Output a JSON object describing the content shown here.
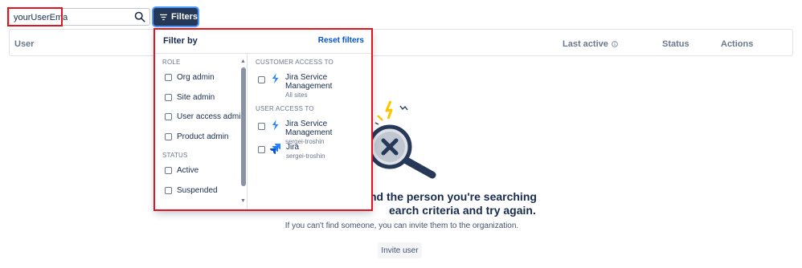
{
  "search": {
    "value": "yourUserEmail"
  },
  "filters_button": {
    "label": "Filters"
  },
  "table": {
    "columns": {
      "user": "User",
      "last_active": "Last active",
      "status": "Status",
      "actions": "Actions"
    }
  },
  "empty_state": {
    "title_line1": "nd the person you're searching",
    "title_line2": "earch criteria and try again.",
    "subtitle": "If you can't find someone, you can invite them to the organization.",
    "invite_label": "Invite user"
  },
  "filter_panel": {
    "title": "Filter by",
    "reset_label": "Reset filters",
    "role_section": "ROLE",
    "roles": [
      "Org admin",
      "Site admin",
      "User access admin",
      "Product admin"
    ],
    "status_section": "STATUS",
    "statuses": [
      "Active",
      "Suspended"
    ],
    "customer_access_section": "CUSTOMER ACCESS TO",
    "customer_access": [
      {
        "name": "Jira Service Management",
        "sub": "All sites",
        "icon": "jira-service-management-icon"
      }
    ],
    "user_access_section": "USER ACCESS TO",
    "user_access": [
      {
        "name": "Jira Service Management",
        "sub": "sergei-troshin",
        "icon": "jira-service-management-icon"
      },
      {
        "name": "Jira",
        "sub": "sergei-troshin",
        "icon": "jira-icon"
      }
    ]
  },
  "colors": {
    "highlight": "#e0151e",
    "button_dark": "#253858",
    "link_blue": "#0052cc",
    "jira_blue": "#2684ff"
  }
}
